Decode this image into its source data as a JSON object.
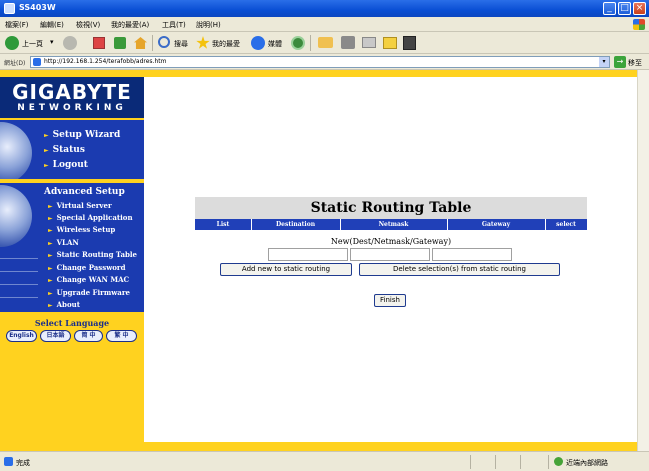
{
  "window": {
    "title": "SS403W"
  },
  "menu": [
    "檔案(F)",
    "編輯(E)",
    "檢視(V)",
    "我的最愛(A)",
    "工具(T)",
    "說明(H)"
  ],
  "toolbar": {
    "back": "上一頁",
    "search": "搜尋",
    "favorites": "我的最愛",
    "media": "媒體"
  },
  "address": {
    "label": "網址(D)",
    "url": "http://192.168.1.254/terafobb/adres.htm",
    "go": "移至"
  },
  "logo": {
    "brand": "GIGABYTE",
    "sub": "NETWORKING"
  },
  "nav_basic": [
    "Setup Wizard",
    "Status",
    "Logout"
  ],
  "nav_advanced": {
    "title": "Advanced Setup",
    "items": [
      "Virtual Server",
      "Special Application",
      "Wireless Setup",
      "VLAN",
      "Static Routing Table",
      "Change Password",
      "Change WAN MAC",
      "Upgrade Firmware",
      "About"
    ]
  },
  "language": {
    "title": "Select Language",
    "options": [
      "English",
      "日本語",
      "简 中",
      "繁 中"
    ]
  },
  "routing": {
    "title": "Static Routing Table",
    "columns": [
      "List",
      "Destination",
      "Netmask",
      "Gateway",
      "select"
    ],
    "new_label": "New(Dest/Netmask/Gateway)",
    "fields": [
      "",
      "",
      ""
    ],
    "add_button": "Add new to static routing",
    "delete_button": "Delete selection(s) from static routing",
    "finish_button": "Finish"
  },
  "status": {
    "text": "完成",
    "zone": "近端內部網路"
  }
}
